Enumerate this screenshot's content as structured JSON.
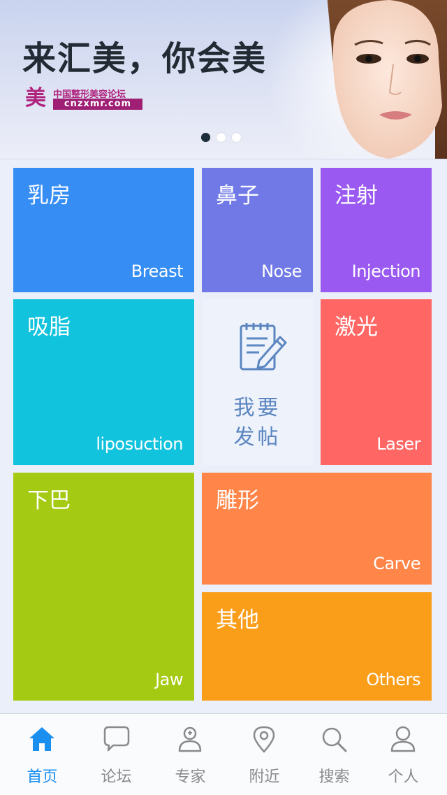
{
  "banner": {
    "slogan": "来汇美，你会美",
    "logo_cn": "中国整形美容论坛",
    "logo_en": "cnzxmr.com",
    "logo_mark": "美",
    "slide_count": 3,
    "active_slide": 1
  },
  "tiles": {
    "breast": {
      "cn": "乳房",
      "en": "Breast",
      "color": "#368ef5"
    },
    "nose": {
      "cn": "鼻子",
      "en": "Nose",
      "color": "#7079e6"
    },
    "injection": {
      "cn": "注射",
      "en": "Injection",
      "color": "#9a5af2"
    },
    "lipo": {
      "cn": "吸脂",
      "en": "liposuction",
      "color": "#12c3dd"
    },
    "laser": {
      "cn": "激光",
      "en": "Laser",
      "color": "#ff6664"
    },
    "jaw": {
      "cn": "下巴",
      "en": "Jaw",
      "color": "#a4ca13"
    },
    "carve": {
      "cn": "雕形",
      "en": "Carve",
      "color": "#ff8548"
    },
    "others": {
      "cn": "其他",
      "en": "Others",
      "color": "#fa9d19"
    }
  },
  "post": {
    "line1": "我要",
    "line2": "发帖",
    "icon": "notepad-pencil-icon"
  },
  "tabbar": {
    "active_color": "#1a8ff0",
    "items": [
      {
        "label": "首页",
        "icon": "home-icon",
        "active": true
      },
      {
        "label": "论坛",
        "icon": "chat-bubble-icon",
        "active": false
      },
      {
        "label": "专家",
        "icon": "doctor-icon",
        "active": false
      },
      {
        "label": "附近",
        "icon": "location-pin-icon",
        "active": false
      },
      {
        "label": "搜索",
        "icon": "search-icon",
        "active": false
      },
      {
        "label": "个人",
        "icon": "person-icon",
        "active": false
      }
    ]
  }
}
